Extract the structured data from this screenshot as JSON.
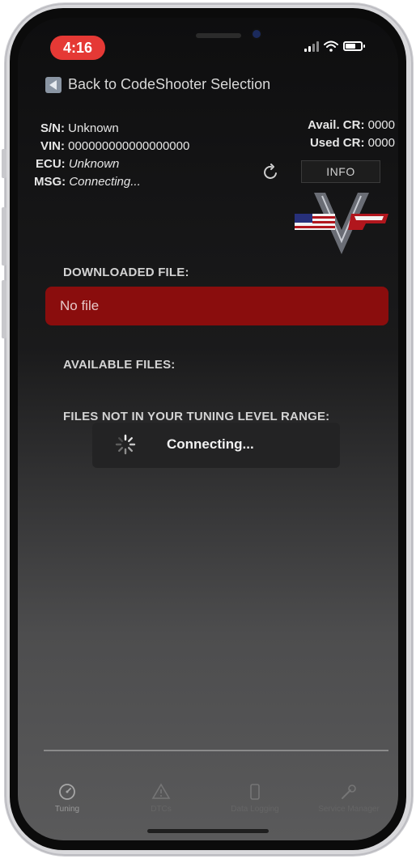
{
  "status_bar": {
    "time": "4:16"
  },
  "nav": {
    "back_label": "Back to CodeShooter Selection"
  },
  "device": {
    "sn_label": "S/N:",
    "sn_value": "Unknown",
    "vin_label": "VIN:",
    "vin_value": "000000000000000000",
    "ecu_label": "ECU:",
    "ecu_value": "Unknown",
    "msg_label": "MSG:",
    "msg_value": "Connecting...",
    "avail_cr_label": "Avail. CR:",
    "avail_cr_value": "0000",
    "used_cr_label": "Used CR:",
    "used_cr_value": "0000"
  },
  "buttons": {
    "info_label": "INFO"
  },
  "sections": {
    "downloaded_title": "DOWNLOADED FILE:",
    "downloaded_value": "No file",
    "available_title": "AVAILABLE FILES:",
    "not_in_range_title": "FILES NOT IN YOUR TUNING LEVEL RANGE:"
  },
  "overlay": {
    "text": "Connecting..."
  },
  "tabs": [
    {
      "label": "Tuning",
      "icon": "gauge-icon"
    },
    {
      "label": "DTCs",
      "icon": "warning-icon"
    },
    {
      "label": "Data Logging",
      "icon": "log-icon"
    },
    {
      "label": "Service Manager",
      "icon": "wrench-icon"
    }
  ],
  "colors": {
    "accent_red": "#e53935",
    "file_box": "#8a0d0d"
  }
}
